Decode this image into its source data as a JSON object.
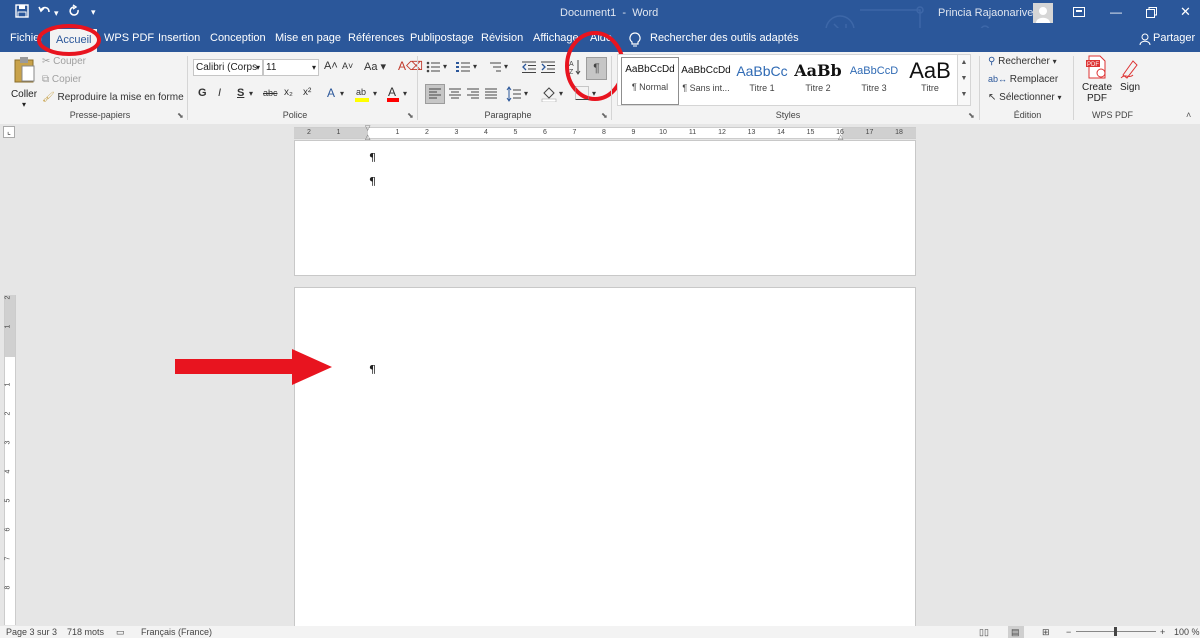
{
  "window": {
    "doc_title": "Document1",
    "app_sep": "-",
    "app_name": "Word",
    "user_name": "Princia Rajaonarivelo"
  },
  "tabs": [
    "Fichier",
    "Accueil",
    "WPS PDF",
    "Insertion",
    "Conception",
    "Mise en page",
    "Références",
    "Publipostage",
    "Révision",
    "Affichage",
    "Aide"
  ],
  "active_tab": "Accueil",
  "tell_me": "Rechercher des outils adaptés",
  "share": "Partager",
  "clipboard": {
    "paste": "Coller",
    "cut": "Couper",
    "copy": "Copier",
    "format_painter": "Reproduire la mise en forme",
    "label": "Presse-papiers"
  },
  "font": {
    "name": "Calibri (Corps",
    "size": "11",
    "label": "Police",
    "bold": "G",
    "italic": "I",
    "underline": "S",
    "strike": "abc",
    "sub": "x₂",
    "sup": "x²",
    "case": "Aa",
    "grow": "A",
    "shrink": "A"
  },
  "paragraph": {
    "label": "Paragraphe",
    "pilcrow": "¶"
  },
  "styles": {
    "label": "Styles",
    "items": [
      {
        "preview": "AaBbCcDd",
        "name": "¶ Normal"
      },
      {
        "preview": "AaBbCcDd",
        "name": "¶ Sans int..."
      },
      {
        "preview": "AaBbCc",
        "name": "Titre 1"
      },
      {
        "preview": "AaBb",
        "name": "Titre 2"
      },
      {
        "preview": "AaBbCcD",
        "name": "Titre 3"
      },
      {
        "preview": "AaB",
        "name": "Titre"
      }
    ]
  },
  "editing": {
    "label": "Édition",
    "find": "Rechercher",
    "replace": "Remplacer",
    "select": "Sélectionner"
  },
  "wps": {
    "label": "WPS PDF",
    "create": "Create",
    "pdf": "PDF",
    "sign": "Sign"
  },
  "ruler_numbers": [
    "2",
    "1",
    "1",
    "2",
    "3",
    "4",
    "5",
    "6",
    "7",
    "8",
    "9",
    "10",
    "11",
    "12",
    "13",
    "14",
    "15",
    "16",
    "17",
    "18"
  ],
  "vruler_numbers": [
    "2",
    "1",
    "1",
    "2",
    "3",
    "4",
    "5",
    "6",
    "7",
    "8"
  ],
  "document": {
    "mark": "¶"
  },
  "status": {
    "page": "Page 3 sur 3",
    "words": "718 mots",
    "language": "Français (France)",
    "zoom": "100 %"
  },
  "colors": {
    "brand": "#2b579a",
    "highlight": "#ffff00",
    "font_color": "#ff0000",
    "annotation": "#ff0000"
  }
}
